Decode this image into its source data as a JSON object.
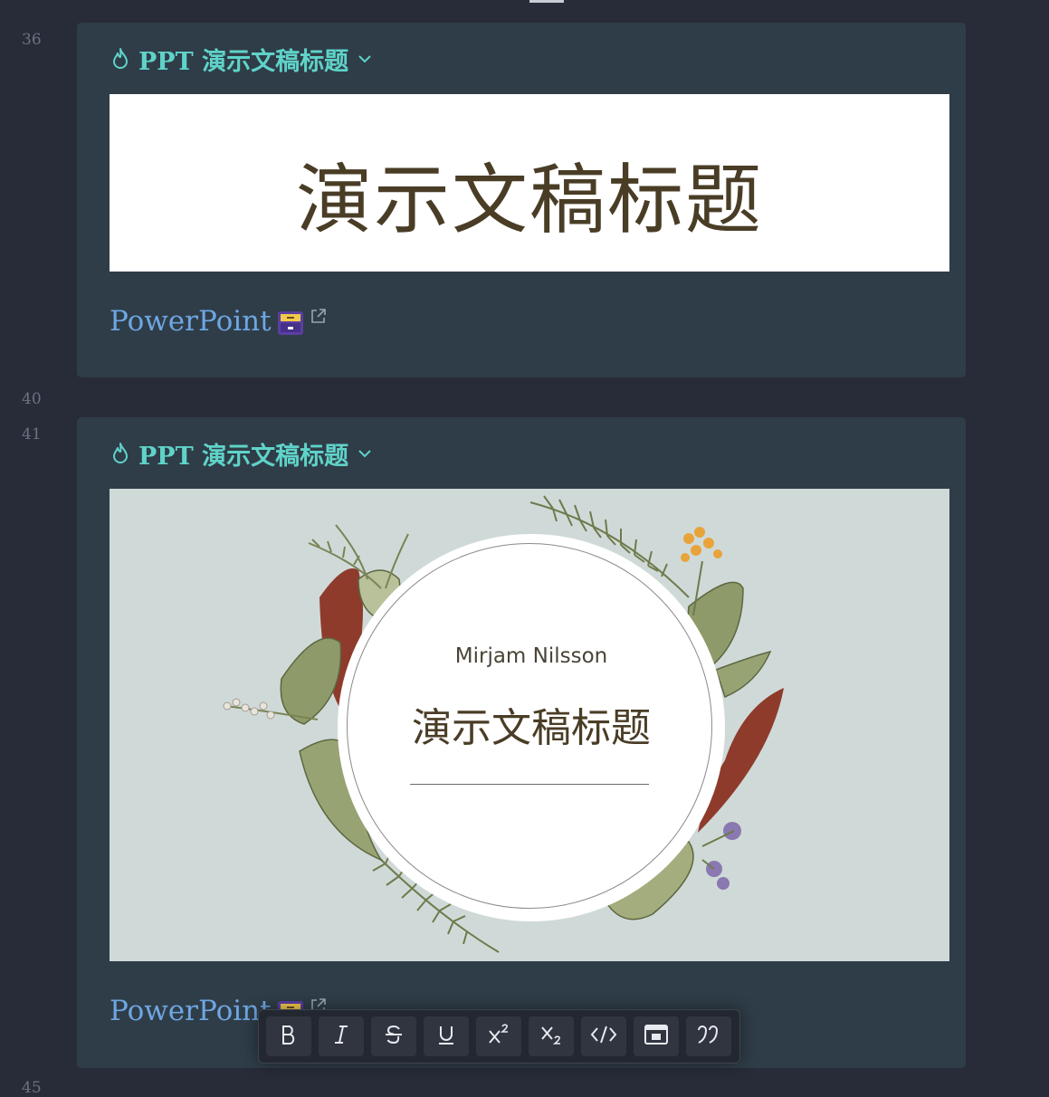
{
  "line_numbers": [
    "36",
    "40",
    "41",
    "45"
  ],
  "cards": [
    {
      "heading": "PPT 演示文稿标题",
      "preview_title": "演示文稿标题",
      "link_text": "PowerPoint"
    },
    {
      "heading": "PPT 演示文稿标题",
      "slide_author": "Mirjam Nilsson",
      "slide_title": "演示文稿标题",
      "link_text": "PowerPoint"
    }
  ],
  "toolbar": {
    "buttons": [
      "bold",
      "italic",
      "strikethrough",
      "underline",
      "superscript",
      "subscript",
      "code",
      "embed",
      "quote"
    ]
  },
  "icons": [
    "fire-icon",
    "chevron-down-icon",
    "file-cabinet-icon",
    "external-link-icon"
  ],
  "colors": {
    "background": "#272c38",
    "card": "#2f3d48",
    "heading": "#5fd3c9",
    "link": "#6ea6e2",
    "slide_background": "#cfdad8"
  }
}
